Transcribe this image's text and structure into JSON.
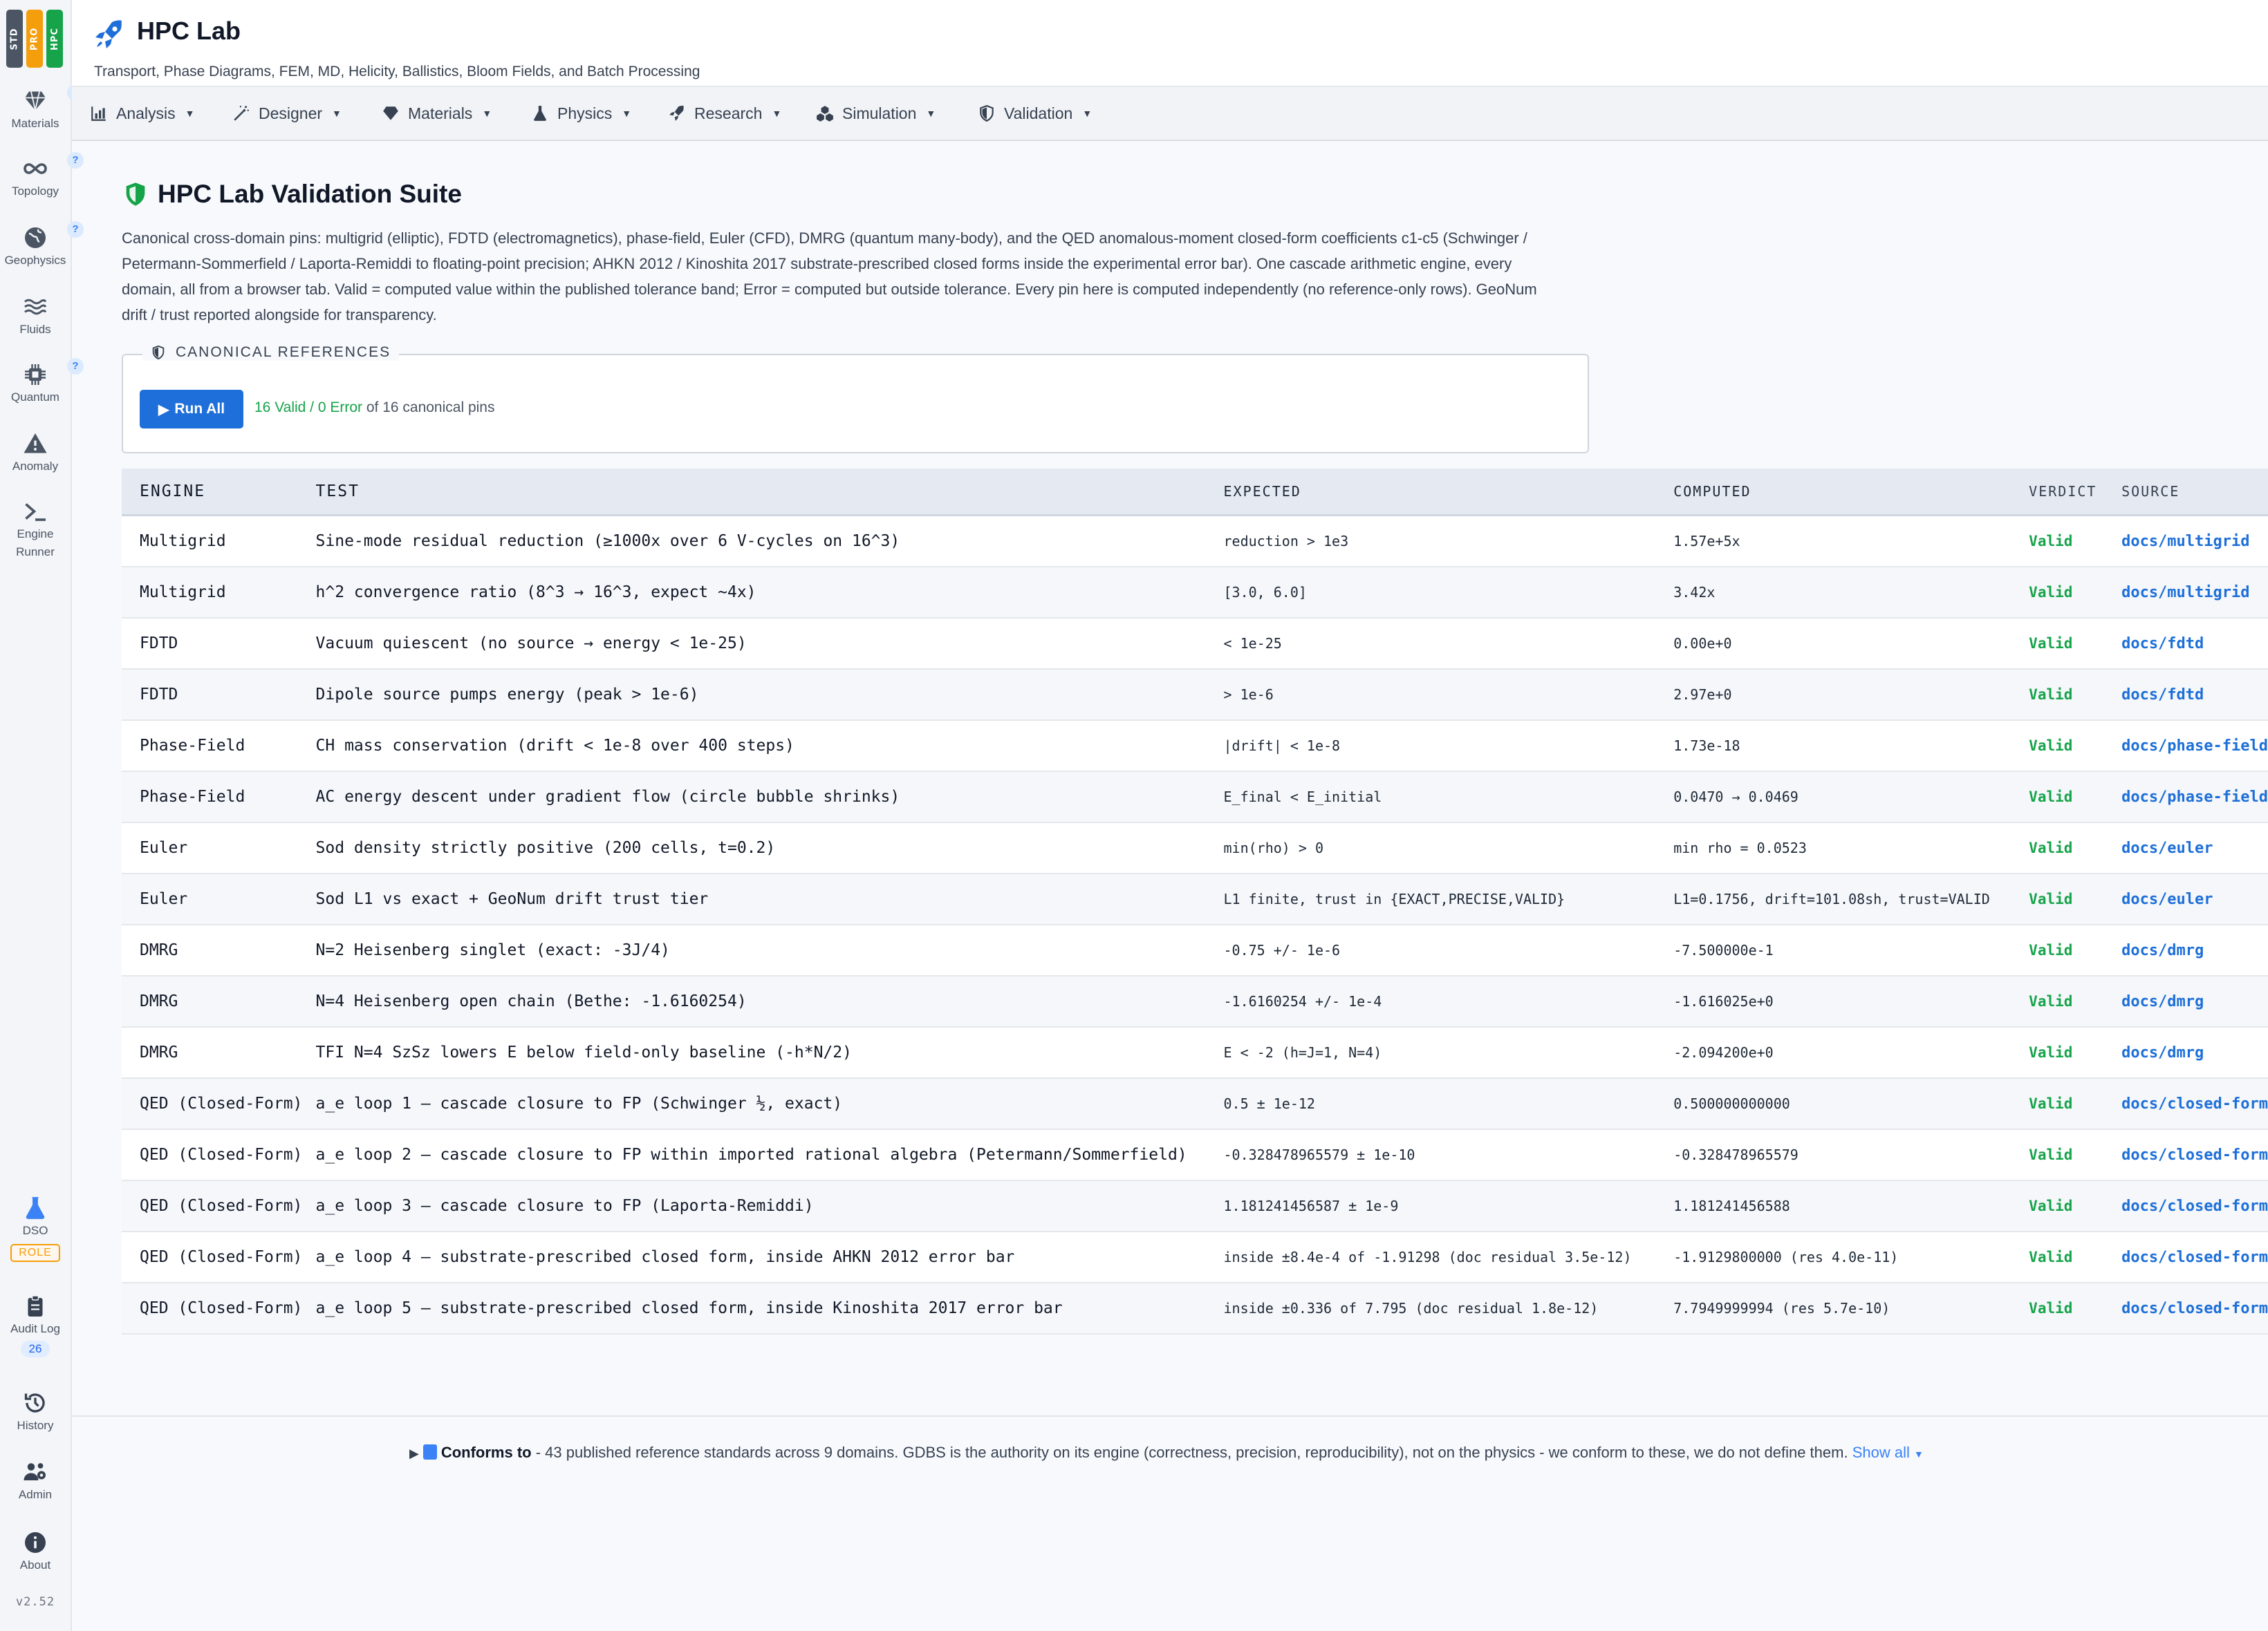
{
  "tiers": [
    {
      "label": "STD",
      "color": "#4b5563"
    },
    {
      "label": "PRO",
      "color": "#f59e0b"
    },
    {
      "label": "HPC",
      "color": "#16a34a"
    }
  ],
  "rail": {
    "materials": "Materials",
    "topology": "Topology",
    "geophysics": "Geophysics",
    "fluids": "Fluids",
    "quantum": "Quantum",
    "anomaly": "Anomaly",
    "engine_runner_1": "Engine",
    "engine_runner_2": "Runner",
    "dso": "DSO",
    "role": "ROLE",
    "audit_log": "Audit Log",
    "audit_count": "26",
    "history": "History",
    "admin": "Admin",
    "about": "About",
    "version": "v2.52",
    "help": "?"
  },
  "header": {
    "title": "HPC Lab",
    "subtitle": "Transport, Phase Diagrams, FEM, MD, Helicity, Ballistics, Bloom Fields, and Batch Processing"
  },
  "menus": [
    "Analysis",
    "Designer",
    "Materials",
    "Physics",
    "Research",
    "Simulation",
    "Validation"
  ],
  "main": {
    "title": "HPC Lab Validation Suite",
    "description": "Canonical cross-domain pins: multigrid (elliptic), FDTD (electromagnetics), phase-field, Euler (CFD), DMRG (quantum many-body), and the QED anomalous-moment closed-form coefficients c1-c5 (Schwinger / Petermann-Sommerfield / Laporta-Remiddi to floating-point precision; AHKN 2012 / Kinoshita 2017 substrate-prescribed closed forms inside the experimental error bar). One cascade arithmetic engine, every domain, all from a browser tab. Valid = computed value within the published tolerance band; Error = computed but outside tolerance. Every pin here is computed independently (no reference-only rows). GeoNum drift / trust reported alongside for transparency.",
    "refs_legend": "CANONICAL REFERENCES",
    "run_all": "Run All",
    "summary_ok": "16 Valid / 0 Error",
    "summary_rest": " of 16 canonical pins"
  },
  "table": {
    "headers": [
      "ENGINE",
      "TEST",
      "EXPECTED",
      "COMPUTED",
      "VERDICT",
      "SOURCE"
    ],
    "rows": [
      [
        "Multigrid",
        "Sine-mode residual reduction (≥1000x over 6 V-cycles on 16^3)",
        "reduction > 1e3",
        "1.57e+5x",
        "Valid",
        "docs/multigrid"
      ],
      [
        "Multigrid",
        "h^2 convergence ratio (8^3 → 16^3, expect ~4x)",
        "[3.0, 6.0]",
        "3.42x",
        "Valid",
        "docs/multigrid"
      ],
      [
        "FDTD",
        "Vacuum quiescent (no source → energy < 1e-25)",
        "< 1e-25",
        "0.00e+0",
        "Valid",
        "docs/fdtd"
      ],
      [
        "FDTD",
        "Dipole source pumps energy (peak > 1e-6)",
        "> 1e-6",
        "2.97e+0",
        "Valid",
        "docs/fdtd"
      ],
      [
        "Phase-Field",
        "CH mass conservation (drift < 1e-8 over 400 steps)",
        "|drift| < 1e-8",
        "1.73e-18",
        "Valid",
        "docs/phase-field"
      ],
      [
        "Phase-Field",
        "AC energy descent under gradient flow (circle bubble shrinks)",
        "E_final < E_initial",
        "0.0470 → 0.0469",
        "Valid",
        "docs/phase-field"
      ],
      [
        "Euler",
        "Sod density strictly positive (200 cells, t=0.2)",
        "min(rho) > 0",
        "min rho = 0.0523",
        "Valid",
        "docs/euler"
      ],
      [
        "Euler",
        "Sod L1 vs exact + GeoNum drift trust tier",
        "L1 finite, trust in {EXACT,PRECISE,VALID}",
        "L1=0.1756, drift=101.08sh, trust=VALID",
        "Valid",
        "docs/euler"
      ],
      [
        "DMRG",
        "N=2 Heisenberg singlet (exact: -3J/4)",
        "-0.75 +/- 1e-6",
        "-7.500000e-1",
        "Valid",
        "docs/dmrg"
      ],
      [
        "DMRG",
        "N=4 Heisenberg open chain (Bethe: -1.6160254)",
        "-1.6160254 +/- 1e-4",
        "-1.616025e+0",
        "Valid",
        "docs/dmrg"
      ],
      [
        "DMRG",
        "TFI N=4 SzSz lowers E below field-only baseline (-h*N/2)",
        "E < -2 (h=J=1, N=4)",
        "-2.094200e+0",
        "Valid",
        "docs/dmrg"
      ],
      [
        "QED (Closed-Form)",
        "a_e loop 1 — cascade closure to FP (Schwinger ½, exact)",
        "0.5 ± 1e-12",
        "0.500000000000",
        "Valid",
        "docs/closed-form"
      ],
      [
        "QED (Closed-Form)",
        "a_e loop 2 — cascade closure to FP within imported rational algebra (Petermann/Sommerfield)",
        "-0.328478965579 ± 1e-10",
        "-0.328478965579",
        "Valid",
        "docs/closed-form"
      ],
      [
        "QED (Closed-Form)",
        "a_e loop 3 — cascade closure to FP (Laporta-Remiddi)",
        "1.181241456587 ± 1e-9",
        "1.181241456588",
        "Valid",
        "docs/closed-form"
      ],
      [
        "QED (Closed-Form)",
        "a_e loop 4 — substrate-prescribed closed form, inside AHKN 2012 error bar",
        "inside ±8.4e-4 of -1.91298 (doc residual 3.5e-12)",
        "-1.9129800000 (res 4.0e-11)",
        "Valid",
        "docs/closed-form"
      ],
      [
        "QED (Closed-Form)",
        "a_e loop 5 — substrate-prescribed closed form, inside Kinoshita 2017 error bar",
        "inside ±0.336 of 7.795 (doc residual 1.8e-12)",
        "7.7949999994 (res 5.7e-10)",
        "Valid",
        "docs/closed-form"
      ]
    ]
  },
  "footer": {
    "conforms_label": "Conforms to",
    "conforms_text": " - 43 published reference standards across 9 domains. GDBS is the authority on its engine (correctness, precision, reproducibility), not on the physics - we conform to these, we do not define them. ",
    "show_all": "Show all"
  },
  "colors": {
    "accent": "#1e6fd9",
    "valid": "#16a34a",
    "link": "#1d6fd8",
    "shield": "#16a34a"
  }
}
